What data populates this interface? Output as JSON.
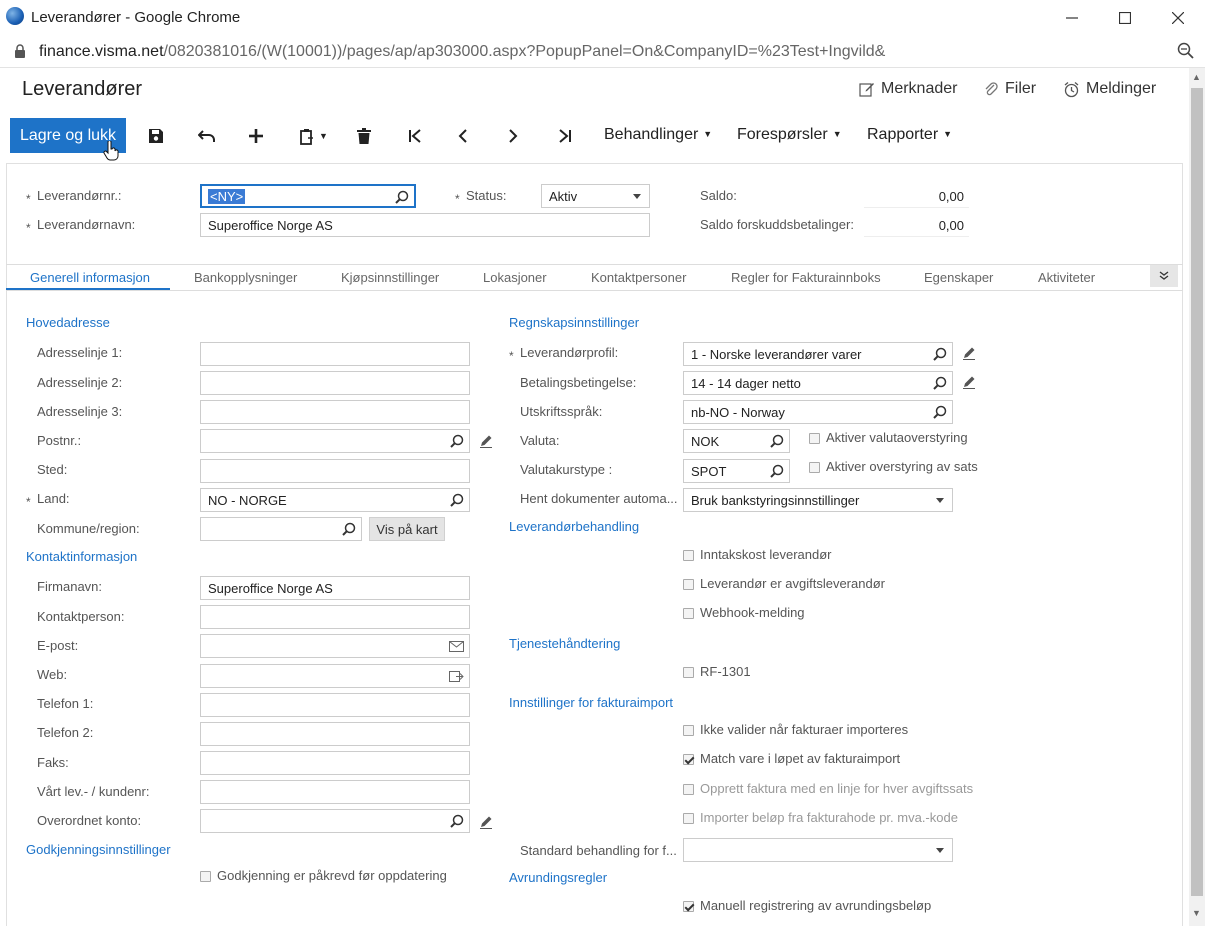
{
  "window": {
    "title": "Leverandører - Google Chrome",
    "url_host": "finance.visma.net",
    "url_path": "/0820381016/(W(10001))/pages/ap/ap303000.aspx?PopupPanel=On&CompanyID=%23Test+Ingvild&"
  },
  "page": {
    "title": "Leverandører",
    "top_links": {
      "notes": "Merknader",
      "files": "Filer",
      "notifications": "Meldinger"
    }
  },
  "toolbar": {
    "save_close": "Lagre og lukk",
    "menus": {
      "actions": "Behandlinger",
      "inquiries": "Forespørsler",
      "reports": "Rapporter"
    }
  },
  "header": {
    "vendor_id_label": "Leverandørnr.:",
    "vendor_id_value": "<NY>",
    "vendor_name_label": "Leverandørnavn:",
    "vendor_name_value": "Superoffice Norge AS",
    "status_label": "Status:",
    "status_value": "Aktiv",
    "balance_label": "Saldo:",
    "balance_value": "0,00",
    "prepay_label": "Saldo forskuddsbetalinger:",
    "prepay_value": "0,00"
  },
  "tabs": [
    "Generell informasjon",
    "Bankopplysninger",
    "Kjøpsinnstillinger",
    "Lokasjoner",
    "Kontaktpersoner",
    "Regler for Fakturainnboks",
    "Egenskaper",
    "Aktiviteter"
  ],
  "left": {
    "main_address": "Hovedadresse",
    "addr1": "Adresselinje 1:",
    "addr2": "Adresselinje 2:",
    "addr3": "Adresselinje 3:",
    "postal": "Postnr.:",
    "city": "Sted:",
    "country": "Land:",
    "country_value": "NO - NORGE",
    "municipality": "Kommune/region:",
    "show_map": "Vis på kart",
    "contact_info": "Kontaktinformasjon",
    "company": "Firmanavn:",
    "company_value": "Superoffice Norge AS",
    "contact_person": "Kontaktperson:",
    "email": "E-post:",
    "web": "Web:",
    "phone1": "Telefon 1:",
    "phone2": "Telefon 2:",
    "fax": "Faks:",
    "our_id": "Vårt lev.- / kundenr:",
    "parent_account": "Overordnet konto:",
    "approval_settings": "Godkjenningsinnstillinger",
    "approval_required": "Godkjenning er påkrevd før oppdatering"
  },
  "right": {
    "accounting_settings": "Regnskapsinnstillinger",
    "vendor_profile": "Leverandørprofil:",
    "vendor_profile_value": "1 - Norske leverandører varer",
    "terms": "Betalingsbetingelse:",
    "terms_value": "14 - 14 dager netto",
    "print_language": "Utskriftsspråk:",
    "print_language_value": "nb-NO - Norway",
    "currency": "Valuta:",
    "currency_value": "NOK",
    "currency_override": "Aktiver valutaoverstyring",
    "rate_type": "Valutakurstype :",
    "rate_type_value": "SPOT",
    "rate_override": "Aktiver overstyring av sats",
    "fetch_docs": "Hent dokumenter automa...",
    "fetch_docs_value": "Bruk bankstyringsinnstillinger",
    "vendor_handling": "Leverandørbehandling",
    "intake_cost": "Inntakskost leverandør",
    "tax_agency": "Leverandør er avgiftsleverandør",
    "webhook": "Webhook-melding",
    "service_handling": "Tjenestehåndtering",
    "rf1301": "RF-1301",
    "invoice_import": "Innstillinger for fakturaimport",
    "no_validate": "Ikke valider når fakturaer importeres",
    "match_item": "Match vare i løpet av fakturaimport",
    "one_line": "Opprett faktura med en linje for hver avgiftssats",
    "import_amount": "Importer beløp fra fakturahode pr. mva.-kode",
    "default_handling": "Standard behandling for f...",
    "rounding_rules": "Avrundingsregler",
    "manual_rounding": "Manuell registrering av avrundingsbeløp"
  },
  "colors": {
    "accent": "#1e73c8"
  }
}
